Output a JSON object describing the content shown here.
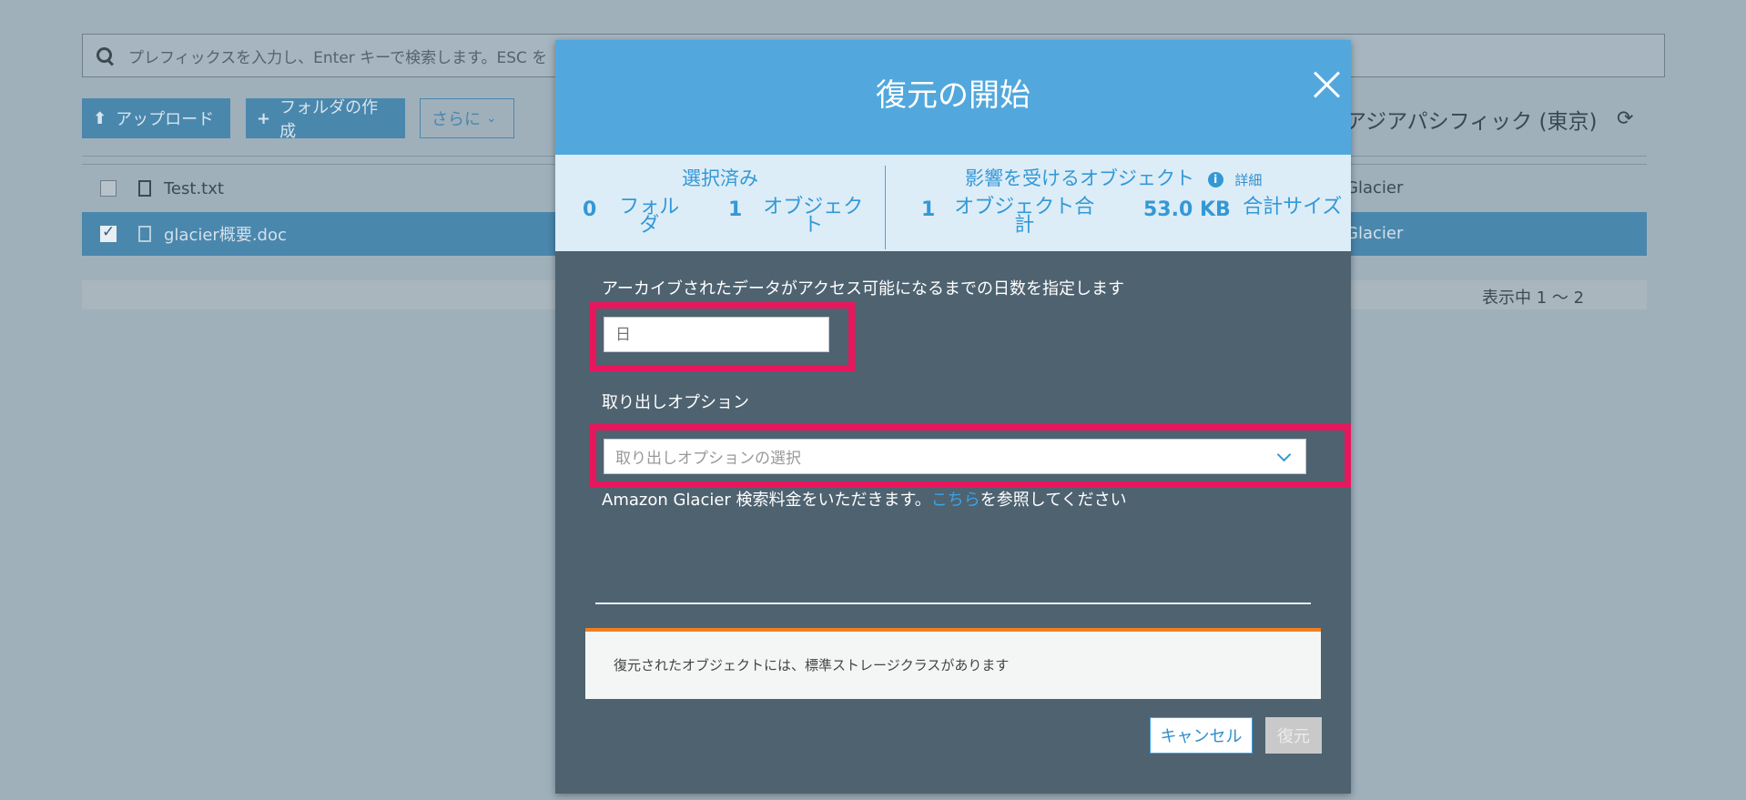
{
  "background": {
    "search_placeholder": "プレフィックスを入力し、Enter キーで検索します。ESC を",
    "upload_label": "アップロード",
    "create_folder_label": "フォルダの作成",
    "more_label": "さらに",
    "region": "アジアパシフィック (東京)",
    "files": [
      {
        "name": "Test.txt",
        "storage": "Glacier",
        "selected": false
      },
      {
        "name": "glacier概要.doc",
        "storage": "Glacier",
        "selected": true
      }
    ],
    "paging": "表示中 1 ～ 2"
  },
  "modal": {
    "title": "復元の開始",
    "selected": {
      "heading": "選択済み",
      "folders_count": "0",
      "folders_label": "フォルダ",
      "objects_count": "1",
      "objects_label": "オブジェクト"
    },
    "affected": {
      "heading": "影響を受けるオブジェクト",
      "detail_link": "詳細",
      "total_objects_count": "1",
      "total_objects_label": "オブジェクト合計",
      "total_size_value": "53.0 KB",
      "total_size_label": "合計サイズ"
    },
    "days_label": "アーカイブされたデータがアクセス可能になるまでの日数を指定します",
    "days_placeholder": "日",
    "retrieval_label": "取り出しオプション",
    "retrieval_placeholder": "取り出しオプションの選択",
    "fee_note_prefix": "Amazon Glacier 検索料金をいただきます。",
    "fee_note_link": "こちら",
    "fee_note_suffix": "を参照してください",
    "notice": "復元されたオブジェクトには、標準ストレージクラスがあります",
    "cancel_label": "キャンセル",
    "restore_label": "復元"
  },
  "colors": {
    "header": "#52a8dd",
    "body": "#4e6270",
    "highlight": "#e8175d",
    "notice_accent": "#f07f22"
  }
}
